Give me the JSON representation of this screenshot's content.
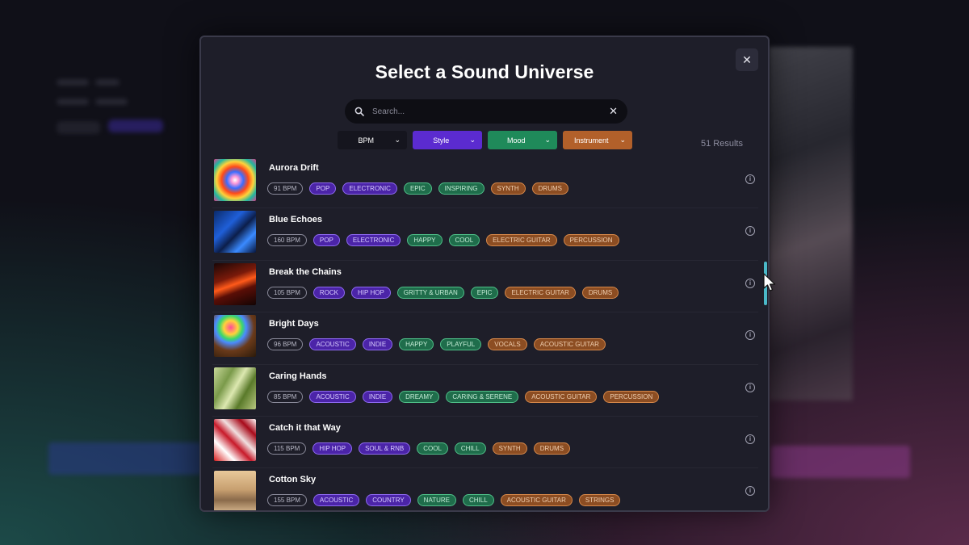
{
  "modal": {
    "title": "Select a Sound Universe",
    "close_label": "✕",
    "search": {
      "placeholder": "Search...",
      "value": "",
      "clear_label": "✕"
    },
    "filters": [
      {
        "label": "BPM",
        "color": "#15151e"
      },
      {
        "label": "Style",
        "color": "#5b2bd0"
      },
      {
        "label": "Mood",
        "color": "#1f8a5a"
      },
      {
        "label": "Instrument",
        "color": "#b2602a"
      }
    ],
    "results": "51 Results"
  },
  "tracks": [
    {
      "name": "Aurora Drift",
      "bpm": "91 BPM",
      "styles": [
        "POP",
        "ELECTRONIC"
      ],
      "moods": [
        "EPIC",
        "INSPIRING"
      ],
      "instruments": [
        "SYNTH",
        "DRUMS"
      ],
      "thumb": "radial-gradient(circle at 50% 50%, #ffffff 0%, #ff9ad8 12%, #3a6dff 28%, #ff4a1a 45%, #ffd23a 62%, #1fb8a0 80%, #e03a8a 100%)"
    },
    {
      "name": "Blue Echoes",
      "bpm": "160 BPM",
      "styles": [
        "POP",
        "ELECTRONIC"
      ],
      "moods": [
        "HAPPY",
        "COOL"
      ],
      "instruments": [
        "ELECTRIC GUITAR",
        "PERCUSSION"
      ],
      "thumb": "linear-gradient(135deg, #0a2a6a 0%, #1f5fd8 35%, #0c1e4a 55%, #3a8aff 75%, #06143a 100%)"
    },
    {
      "name": "Break the Chains",
      "bpm": "105 BPM",
      "styles": [
        "ROCK",
        "HIP HOP"
      ],
      "moods": [
        "GRITTY & URBAN",
        "EPIC"
      ],
      "instruments": [
        "ELECTRIC GUITAR",
        "DRUMS"
      ],
      "thumb": "linear-gradient(160deg, #1a0606 0%, #7a1a0a 35%, #ff5a1a 50%, #5a0e06 65%, #120404 100%)"
    },
    {
      "name": "Bright Days",
      "bpm": "96 BPM",
      "styles": [
        "ACOUSTIC",
        "INDIE"
      ],
      "moods": [
        "HAPPY",
        "PLAYFUL"
      ],
      "instruments": [
        "VOCALS",
        "ACOUSTIC GUITAR"
      ],
      "thumb": "radial-gradient(circle at 40% 30%, #ff4a9a 0%, #ffd23a 18%, #3ad86a 30%, #4a8aff 40%, #6a3a1a 60%, #2a1a0a 100%)"
    },
    {
      "name": "Caring Hands",
      "bpm": "85 BPM",
      "styles": [
        "ACOUSTIC",
        "INDIE"
      ],
      "moods": [
        "DREAMY",
        "CARING & SERENE"
      ],
      "instruments": [
        "ACOUSTIC GUITAR",
        "PERCUSSION"
      ],
      "thumb": "linear-gradient(120deg, #c8d89a 0%, #7a9a4a 30%, #dce8b0 50%, #5a7a2a 70%, #b8c880 100%)"
    },
    {
      "name": "Catch it that Way",
      "bpm": "115 BPM",
      "styles": [
        "HIP HOP",
        "SOUL & RNB"
      ],
      "moods": [
        "COOL",
        "CHILL"
      ],
      "instruments": [
        "SYNTH",
        "DRUMS"
      ],
      "thumb": "linear-gradient(45deg, #d81a1a 0%, #ffffff 25%, #c81a2a 45%, #f0e0e0 60%, #a80a1a 80%, #ffffff 100%)"
    },
    {
      "name": "Cotton Sky",
      "bpm": "155 BPM",
      "styles": [
        "ACOUSTIC",
        "COUNTRY"
      ],
      "moods": [
        "NATURE",
        "CHILL"
      ],
      "instruments": [
        "ACOUSTIC GUITAR",
        "STRINGS"
      ],
      "thumb": "linear-gradient(180deg, #e8c89a 0%, #c8a070 45%, #8a6a4a 70%, #d8b890 100%)"
    }
  ]
}
